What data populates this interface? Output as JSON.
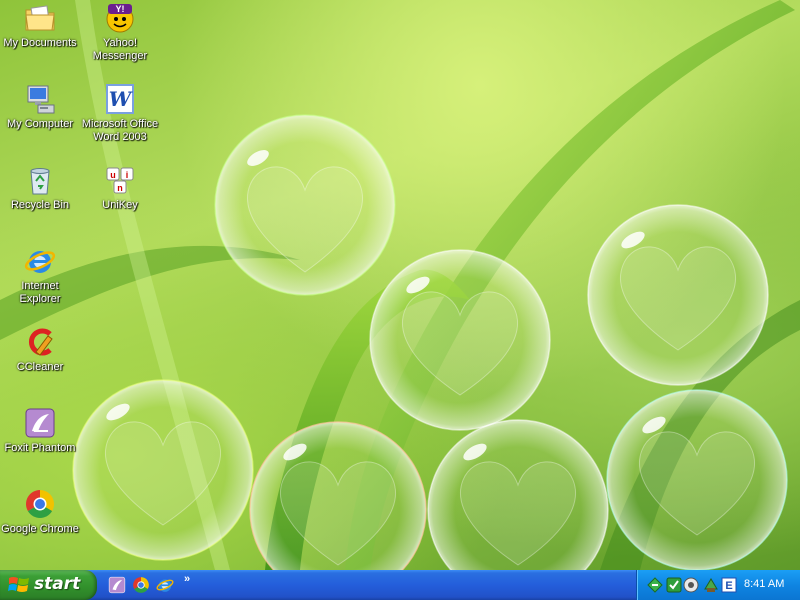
{
  "desktop": {
    "icons": [
      {
        "label": "My Documents",
        "icon": "folder-documents-icon"
      },
      {
        "label": "Yahoo! Messenger",
        "icon": "yahoo-messenger-icon"
      },
      {
        "label": "My Computer",
        "icon": "computer-icon"
      },
      {
        "label": "Microsoft Office Word 2003",
        "icon": "word-icon"
      },
      {
        "label": "Recycle Bin",
        "icon": "recycle-bin-icon"
      },
      {
        "label": "UniKey",
        "icon": "unikey-icon"
      },
      {
        "label": "Internet Explorer",
        "icon": "internet-explorer-icon"
      },
      {
        "label": "CCleaner",
        "icon": "ccleaner-icon"
      },
      {
        "label": "Foxit Phantom",
        "icon": "foxit-phantom-icon"
      },
      {
        "label": "Google Chrome",
        "icon": "chrome-icon"
      }
    ]
  },
  "taskbar": {
    "start_label": "start",
    "quick_launch": [
      "foxit-phantom-icon",
      "chrome-icon",
      "internet-explorer-icon"
    ],
    "overflow_label": "»",
    "tray_icons": [
      "network-icon",
      "unikey-tray-icon",
      "update-icon",
      "security-icon",
      "ime-icon"
    ],
    "clock": "8:41 AM"
  },
  "colors": {
    "taskbar_blue": "#245edb",
    "start_green": "#3c9f36",
    "tray_blue": "#0f85e2"
  }
}
